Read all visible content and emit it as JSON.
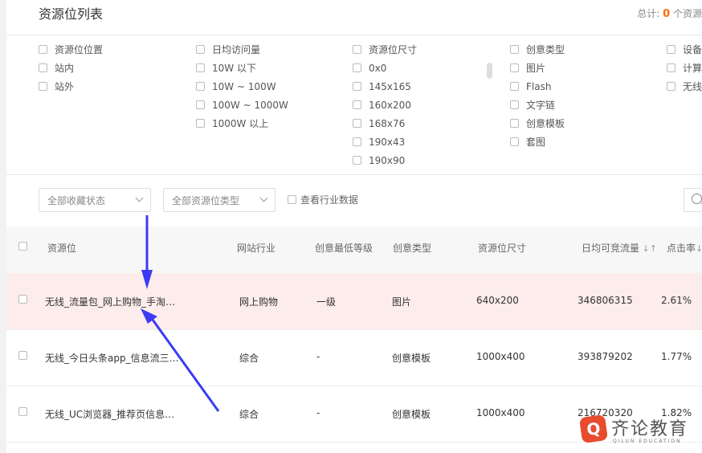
{
  "header": {
    "title": "资源位列表",
    "total_label": "总计:",
    "total_count": "0",
    "total_suffix": "个资源"
  },
  "filters": {
    "col1": [
      "资源位位置",
      "站内",
      "站外"
    ],
    "col2": [
      "日均访问量",
      "10W 以下",
      "10W ~ 100W",
      "100W ~ 1000W",
      "1000W 以上"
    ],
    "col3": [
      "资源位尺寸",
      "0x0",
      "145x165",
      "160x200",
      "168x76",
      "190x43",
      "190x90"
    ],
    "col4": [
      "创意类型",
      "图片",
      "Flash",
      "文字链",
      "创意模板",
      "套图"
    ],
    "col5": [
      "设备",
      "计算",
      "无线"
    ]
  },
  "toolbar": {
    "collect_select": "全部收藏状态",
    "type_select": "全部资源位类型",
    "industry_label": "查看行业数据"
  },
  "table": {
    "headers": [
      "资源位",
      "网站行业",
      "创意最低等级",
      "创意类型",
      "资源位尺寸",
      "日均可竞流量",
      "点击率"
    ],
    "rows": [
      {
        "name": "无线_流量包_网上购物_手淘…",
        "industry": "网上购物",
        "level": "一级",
        "type": "图片",
        "size": "640x200",
        "traffic": "346806315",
        "ctr": "2.61%"
      },
      {
        "name": "无线_今日头条app_信息流三…",
        "industry": "综合",
        "level": "-",
        "type": "创意模板",
        "size": "1000x400",
        "traffic": "393879202",
        "ctr": "1.77%"
      },
      {
        "name": "无线_UC浏览器_推荐页信息…",
        "industry": "综合",
        "level": "-",
        "type": "创意模板",
        "size": "1000x400",
        "traffic": "216720320",
        "ctr": "1.82%"
      }
    ]
  },
  "watermark": {
    "name": "齐论教育",
    "sub": "QILUN EDUCATION"
  },
  "colors": {
    "accent": "#ff6a00",
    "highlight_row": "#fdecec",
    "arrow": "#3b3bf5"
  }
}
